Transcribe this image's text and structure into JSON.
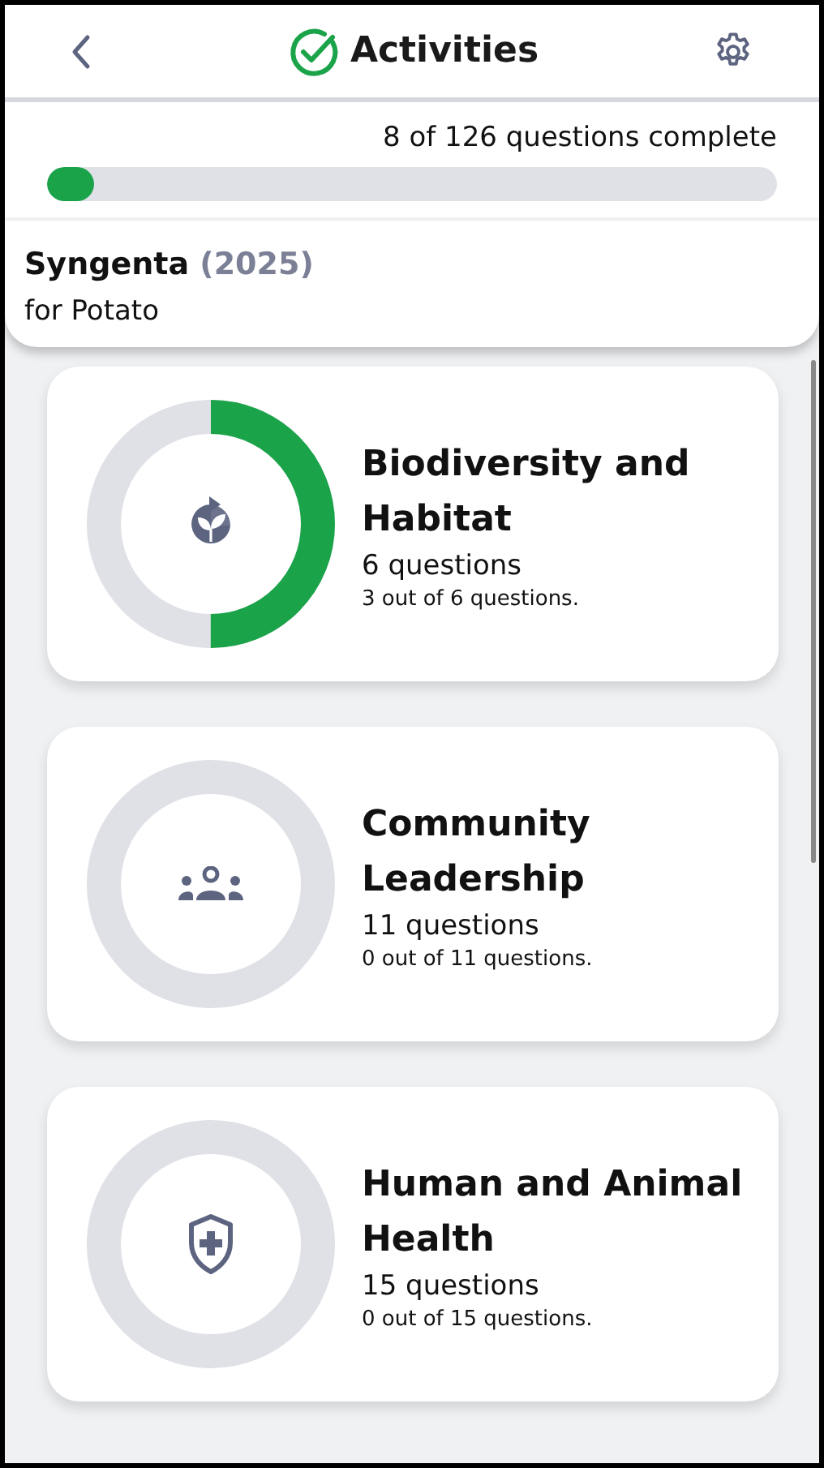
{
  "header": {
    "title": "Activities"
  },
  "progress": {
    "label": "8 of 126 questions complete",
    "level": 0.0635
  },
  "company": {
    "name": "Syngenta",
    "year": "(2025)",
    "crop": "for Potato"
  },
  "activities": [
    {
      "kind": "plant",
      "title": "Biodiversity and Habitat",
      "count": "6 questions",
      "detail": "3 out of 6 questions."
    },
    {
      "kind": "people",
      "title": "Community Leadership",
      "count": "11 questions",
      "detail": "0 out of 11 questions."
    },
    {
      "kind": "shield",
      "title": "Human and Animal Health",
      "count": "15 questions",
      "detail": "0 out of 15 questions."
    }
  ]
}
